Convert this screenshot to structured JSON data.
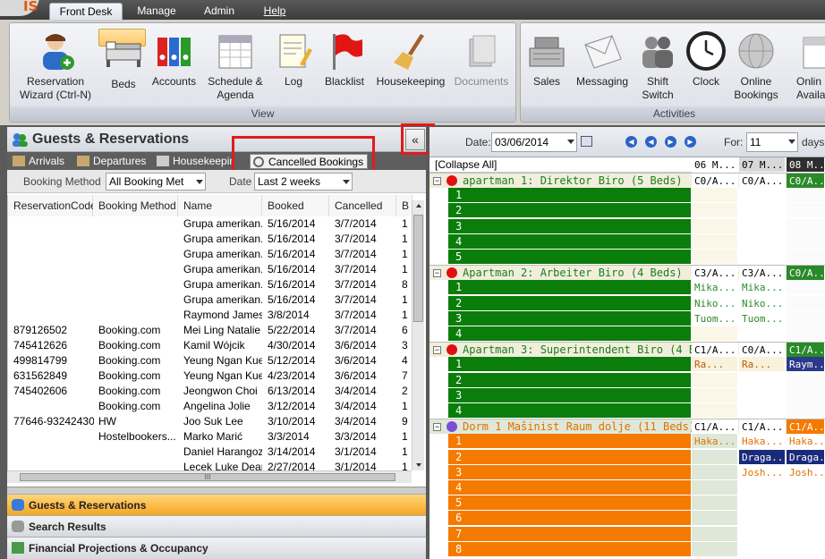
{
  "app": {
    "logo": "IS"
  },
  "menu": {
    "tabs": [
      "Front Desk",
      "Manage",
      "Admin",
      "Help"
    ]
  },
  "ribbon": {
    "view": {
      "label": "View",
      "buttons": [
        {
          "label": "Reservation Wizard (Ctrl-N)",
          "icon": "person-add-icon"
        },
        {
          "label": "Beds",
          "icon": "beds-icon",
          "selected": true
        },
        {
          "label": "Accounts",
          "icon": "binders-icon"
        },
        {
          "label": "Schedule & Agenda",
          "icon": "calendar-icon"
        },
        {
          "label": "Log",
          "icon": "log-notepad-icon"
        },
        {
          "label": "Blacklist",
          "icon": "red-flag-icon"
        },
        {
          "label": "Housekeeping",
          "icon": "broom-icon"
        },
        {
          "label": "Documents",
          "icon": "documents-icon",
          "disabled": true
        }
      ]
    },
    "activities": {
      "label": "Activities",
      "buttons": [
        {
          "label": "Sales",
          "icon": "cash-register-icon"
        },
        {
          "label": "Messaging",
          "icon": "envelope-icon"
        },
        {
          "label": "Shift Switch",
          "icon": "people-icon"
        },
        {
          "label": "Clock",
          "icon": "clock-icon"
        },
        {
          "label": "Online Bookings",
          "icon": "globe-icon"
        },
        {
          "label": "Onlin Availab",
          "icon": "calendar-may-icon"
        }
      ]
    }
  },
  "left": {
    "title": "Guests & Reservations",
    "subtabs": [
      "Arrivals",
      "Departures",
      "Housekeeping",
      "Cancelled Bookings"
    ],
    "filter": {
      "booking_label": "Booking Method",
      "booking_value": "All Booking Met",
      "date_label": "Date",
      "date_value": "Last 2 weeks"
    },
    "columns": [
      "ReservationCode",
      "Booking Method",
      "Name",
      "Booked",
      "Cancelled",
      "B"
    ],
    "rows": [
      [
        "",
        "",
        "Grupa amerikan...",
        "5/16/2014",
        "3/7/2014",
        "1"
      ],
      [
        "",
        "",
        "Grupa amerikan...",
        "5/16/2014",
        "3/7/2014",
        "1"
      ],
      [
        "",
        "",
        "Grupa amerikan...",
        "5/16/2014",
        "3/7/2014",
        "1"
      ],
      [
        "",
        "",
        "Grupa amerikan...",
        "5/16/2014",
        "3/7/2014",
        "1"
      ],
      [
        "",
        "",
        "Grupa amerikan...",
        "5/16/2014",
        "3/7/2014",
        "8"
      ],
      [
        "",
        "",
        "Grupa amerikan...",
        "5/16/2014",
        "3/7/2014",
        "1"
      ],
      [
        "",
        "",
        "Raymond James...",
        "3/8/2014",
        "3/7/2014",
        "1"
      ],
      [
        "879126502",
        "Booking.com",
        "Mei Ling Natalie ...",
        "5/22/2014",
        "3/7/2014",
        "6"
      ],
      [
        "745412626",
        "Booking.com",
        "Kamil Wójcik",
        "4/30/2014",
        "3/6/2014",
        "3"
      ],
      [
        "499814799",
        "Booking.com",
        "Yeung Ngan Kuen",
        "5/12/2014",
        "3/6/2014",
        "4"
      ],
      [
        "631562849",
        "Booking.com",
        "Yeung Ngan Kuen",
        "4/23/2014",
        "3/6/2014",
        "7"
      ],
      [
        "745402606",
        "Booking.com",
        "Jeongwon Choi",
        "6/13/2014",
        "3/4/2014",
        "2"
      ],
      [
        "",
        "Booking.com",
        "Angelina Jolie",
        "3/12/2014",
        "3/4/2014",
        "1"
      ],
      [
        "77646-93242430",
        "HW",
        "Joo Suk Lee",
        "3/10/2014",
        "3/4/2014",
        "9"
      ],
      [
        "",
        "Hostelbookers...",
        "Marko  Marić",
        "3/3/2014",
        "3/3/2014",
        "1"
      ],
      [
        "",
        "",
        "Daniel Harangoz...",
        "3/14/2014",
        "3/1/2014",
        "1"
      ],
      [
        "",
        "",
        "Lecek Luke Dean",
        "2/27/2014",
        "3/1/2014",
        "1"
      ]
    ],
    "hscroll_label": "III",
    "nav": [
      "Guests & Reservations",
      "Search Results",
      "Financial Projections & Occupancy"
    ]
  },
  "right": {
    "collapse_glyph": "«",
    "date_label": "Date:",
    "date_value": "03/06/2014",
    "for_label": "For:",
    "for_value": "11",
    "days_label": "days",
    "collapse_all": "[Collapse All]",
    "day_headers": [
      "06 M...",
      "07 M...",
      "08 M..."
    ],
    "rows": [
      {
        "type": "room",
        "label": "apartman 1: Direktor Biro (5 Beds)",
        "cells": [
          "C0/A...",
          "C0/A...",
          "C0/A..."
        ],
        "color": "#1a7f1a",
        "marker": "#e01010"
      },
      {
        "type": "bed",
        "label": "1",
        "bg": "#0a7d0a",
        "cells": [
          "",
          "",
          ""
        ]
      },
      {
        "type": "bed",
        "label": "2",
        "bg": "#0a7d0a",
        "cells": [
          "",
          "",
          ""
        ]
      },
      {
        "type": "bed",
        "label": "3",
        "bg": "#0a7d0a",
        "cells": [
          "",
          "",
          ""
        ]
      },
      {
        "type": "bed",
        "label": "4",
        "bg": "#0a7d0a",
        "cells": [
          "",
          "",
          ""
        ]
      },
      {
        "type": "bed",
        "label": "5",
        "bg": "#0a7d0a",
        "cells": [
          "",
          "",
          ""
        ]
      },
      {
        "type": "room",
        "label": "Apartman 2: Arbeiter Biro (4 Beds)",
        "cells": [
          "C3/A...",
          "C3/A...",
          "C0/A..."
        ],
        "color": "#1a7f1a",
        "marker": "#e01010"
      },
      {
        "type": "bed",
        "label": "1",
        "bg": "#0a7d0a",
        "cells": [
          "Mika...",
          "Mika...",
          ""
        ]
      },
      {
        "type": "bed",
        "label": "2",
        "bg": "#0a7d0a",
        "cells": [
          "Niko...",
          "Niko...",
          ""
        ]
      },
      {
        "type": "bed",
        "label": "3",
        "bg": "#0a7d0a",
        "cells": [
          "Tuom...",
          "Tuom...",
          ""
        ]
      },
      {
        "type": "bed",
        "label": "4",
        "bg": "#0a7d0a",
        "cells": [
          "",
          "",
          ""
        ]
      },
      {
        "type": "room",
        "label": "Apartman 3: Superintendent Biro (4 Beds)",
        "cells": [
          "C1/A...",
          "C0/A...",
          "C1/A..."
        ],
        "color": "#1a7f1a",
        "marker": "#e01010"
      },
      {
        "type": "bed",
        "label": "1",
        "bg": "#0a7d0a",
        "cells": [
          "Ra...",
          "Ra...",
          "Raym..."
        ]
      },
      {
        "type": "bed",
        "label": "2",
        "bg": "#0a7d0a",
        "cells": [
          "",
          "",
          ""
        ]
      },
      {
        "type": "bed",
        "label": "3",
        "bg": "#0a7d0a",
        "cells": [
          "",
          "",
          ""
        ]
      },
      {
        "type": "bed",
        "label": "4",
        "bg": "#0a7d0a",
        "cells": [
          "",
          "",
          ""
        ]
      },
      {
        "type": "room",
        "label": "Dorm 1 Mašinist Raum dolje (11 Beds)",
        "cells": [
          "C1/A...",
          "C1/A...",
          "C1/A..."
        ],
        "color": "#e07000",
        "marker": "#7a4fd6"
      },
      {
        "type": "bed",
        "label": "1",
        "bg": "#f47a00",
        "cells": [
          "Haka...",
          "Haka...",
          "Haka..."
        ]
      },
      {
        "type": "bed",
        "label": "2",
        "bg": "#f47a00",
        "cells": [
          "",
          "Draga...",
          "Draga..."
        ]
      },
      {
        "type": "bed",
        "label": "3",
        "bg": "#f47a00",
        "cells": [
          "",
          "Josh...",
          "Josh..."
        ]
      },
      {
        "type": "bed",
        "label": "4",
        "bg": "#f47a00",
        "cells": [
          "",
          "",
          ""
        ]
      },
      {
        "type": "bed",
        "label": "5",
        "bg": "#f47a00",
        "cells": [
          "",
          "",
          ""
        ]
      },
      {
        "type": "bed",
        "label": "6",
        "bg": "#f47a00",
        "cells": [
          "",
          "",
          ""
        ]
      },
      {
        "type": "bed",
        "label": "7",
        "bg": "#f47a00",
        "cells": [
          "",
          "",
          ""
        ]
      },
      {
        "type": "bed",
        "label": "8",
        "bg": "#f47a00",
        "cells": [
          "",
          "",
          ""
        ]
      }
    ]
  }
}
